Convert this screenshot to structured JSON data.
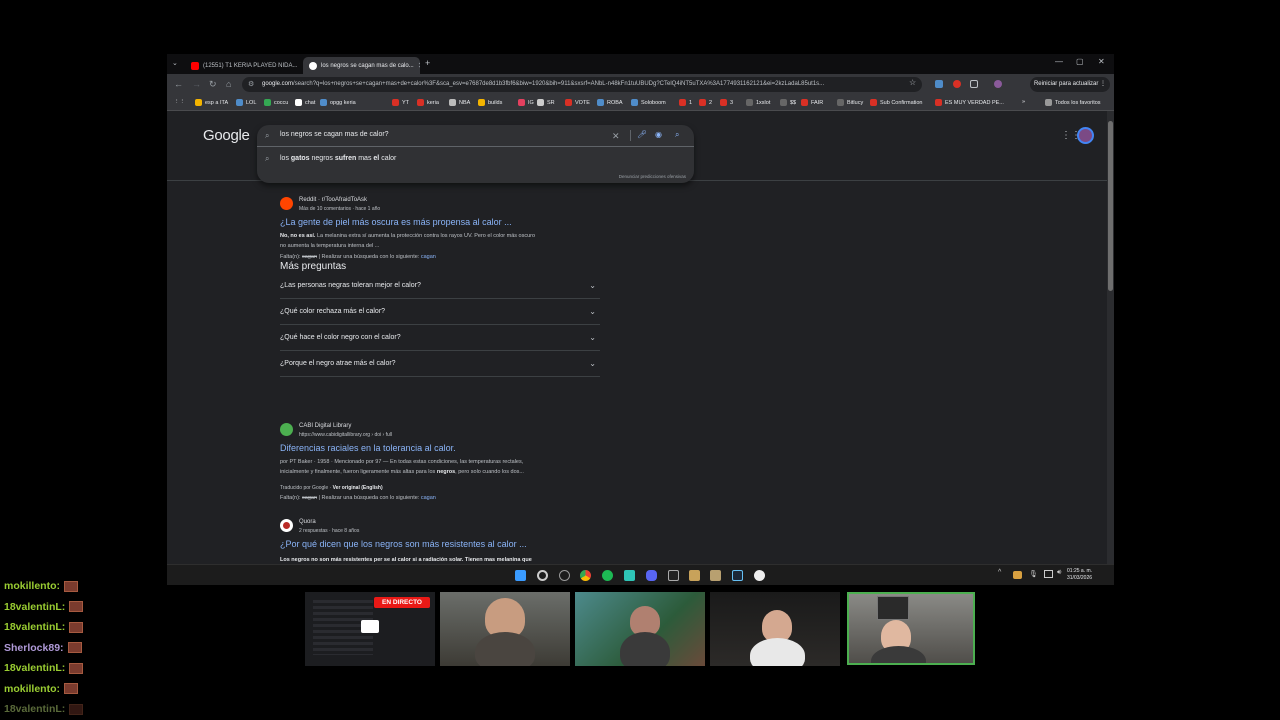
{
  "browser": {
    "tabs": [
      {
        "title": "(12551) T1 KERIA PLAYED NIDA...",
        "active": false
      },
      {
        "title": "los negros se cagan mas de calo...",
        "active": true
      }
    ],
    "new_tab": "+",
    "window_controls": [
      "—",
      "▢",
      "✕"
    ],
    "url_host": "google.com",
    "url_rest": "/search?q=los+negros+se+cagan+mas+de+calor%3F&sca_esv=e7687de8d1b3fbf6&biw=1920&bih=911&sxsrf=ANbL-n48kFn1tuUBUDg?CTelQ4iNT5uTXA%3A1774931162121&ei=2kzLadaL85ut1s...",
    "update_button": "Reiniciar para actualizar",
    "bookmarks": [
      "esp a ITA",
      "LOL",
      "coccu",
      "chat",
      "opgg keria",
      "YT",
      "keria",
      "NBA",
      "builds",
      "IG",
      "SR",
      "VOTE",
      "ROBA",
      "Soloboom",
      "1",
      "2",
      "3",
      "1xslot",
      "$$",
      "FAIR",
      "Bitlucy",
      "Sub Confirmation",
      "ES MUY VERDAD PE...",
      "Todos los favoritos"
    ]
  },
  "google": {
    "logo": "Google",
    "query": "los negros se cagan mas de calor?",
    "suggestion": {
      "pre": "los ",
      "b1": "gatos",
      "mid": " negros ",
      "b2": "sufren",
      "mid2": " mas ",
      "b3": "el",
      "post": " calor"
    },
    "report": "Denunciar predicciones ofensivas",
    "results": [
      {
        "site": "Reddit · r/TooAfraidToAsk",
        "meta": "Más de 10 comentarios · hace 1 año",
        "title": "¿La gente de piel más oscura es más propensa al calor ...",
        "snippet1_b": "No, no es así.",
        "snippet1": " La melanina extra sí aumenta la protección contra los rayos UV. Pero el color más oscuro",
        "snippet2": "no aumenta la temperatura interna del ...",
        "missing_prefix": "Falta(n): ",
        "missing_word": "cagan",
        "missing_mid": " | Realizar una búsqueda con lo siguiente: ",
        "missing_link": "cagan"
      },
      {
        "site": "CABI Digital Library",
        "meta": "https://www.cabidigitallibrary.org › doi › full",
        "title": "Diferencias raciales en la tolerancia al calor.",
        "snippet1": "por PT Baker · 1958 · Mencionado por 97 — En todas estas condiciones, las temperaturas rectales,",
        "snippet2_a": "inicialmente y finalmente, fueron ligeramente más altas para los ",
        "snippet2_b": "negros",
        "snippet2_c": ", pero solo cuando los dos...",
        "translated": "Traducido por Google · ",
        "translated_link": "Ver original (English)",
        "missing_prefix": "Falta(n): ",
        "missing_word": "cagan",
        "missing_mid": " | Realizar una búsqueda con lo siguiente: ",
        "missing_link": "cagan"
      },
      {
        "site": "Quora",
        "meta": "2 respuestas · hace 8 años",
        "title": "¿Por qué dicen que los negros son más resistentes al calor ...",
        "snippet1": "Los negros no son más resistentes per se al calor si a radiación solar. Tienen mas melanina que"
      }
    ],
    "paa_title": "Más preguntas",
    "paa": [
      "¿Las personas negras toleran mejor el calor?",
      "¿Qué color rechaza más el calor?",
      "¿Qué hace el color negro con el calor?",
      "¿Porque el negro atrae más el calor?"
    ]
  },
  "taskbar": {
    "time": "01:25 a. m.",
    "date": "31/03/2026"
  },
  "stream": {
    "live_badge": "EN DIRECTO",
    "chat": [
      {
        "user": "mokillento:",
        "color": "#9acd32"
      },
      {
        "user": "18valentinL:",
        "color": "#9acd32"
      },
      {
        "user": "18valentinL:",
        "color": "#9acd32"
      },
      {
        "user": "Sherlock89:",
        "color": "#b09ad8"
      },
      {
        "user": "18valentinL:",
        "color": "#9acd32"
      },
      {
        "user": "mokillento:",
        "color": "#9acd32"
      },
      {
        "user": "18valentinL:",
        "color": "#5a6a3a"
      }
    ]
  },
  "colors": {
    "link": "#8ab4f8",
    "accent": "#4285f4",
    "live": "#e91916"
  }
}
